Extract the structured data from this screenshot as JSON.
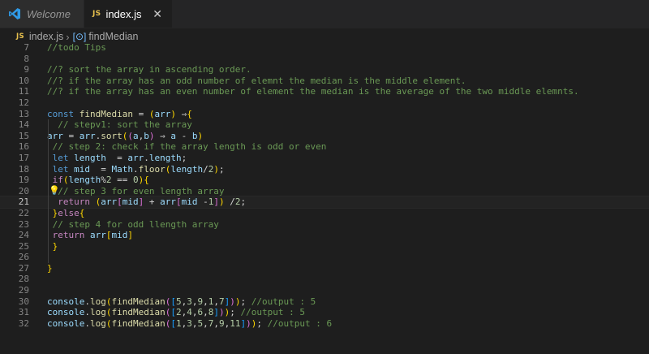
{
  "tabs": [
    {
      "label": "Welcome",
      "icon": "vscode-logo-icon",
      "active": false
    },
    {
      "label": "index.js",
      "badge": "JS",
      "icon": "js-file-icon",
      "active": true,
      "close": "✕"
    }
  ],
  "breadcrumb": {
    "file_badge": "JS",
    "file": "index.js",
    "symbol": "findMedian"
  },
  "colors": {
    "comment": "#6a9955",
    "keyword": "#569cd6",
    "function": "#dcdcaa",
    "variable": "#9cdcfe",
    "number": "#b5cea8"
  },
  "editor": {
    "current_line": 21,
    "lines": [
      {
        "n": "7",
        "t": "//todo Tips"
      },
      {
        "n": "8",
        "t": ""
      },
      {
        "n": "9",
        "t": "//? sort the array in ascending order."
      },
      {
        "n": "10",
        "t": "//? if the array has an odd number of elemnt the median is the middle element."
      },
      {
        "n": "11",
        "t": "//? if the array has an even number of element the median is the average of the two middle elemnts."
      },
      {
        "n": "12",
        "t": ""
      },
      {
        "n": "13",
        "t": "const findMedian = (arr) ⇒{"
      },
      {
        "n": "14",
        "t": "  // stepv1: sort the array"
      },
      {
        "n": "15",
        "t": "arr = arr.sort((a,b) ⇒ a - b)"
      },
      {
        "n": "16",
        "t": " // step 2: check if the array length is odd or even"
      },
      {
        "n": "17",
        "t": " let length  = arr.length;"
      },
      {
        "n": "18",
        "t": " let mid  = Math.floor(length/2);"
      },
      {
        "n": "19",
        "t": " if(length%2 == 0){"
      },
      {
        "n": "20",
        "t": "  // step 3 for even length array"
      },
      {
        "n": "21",
        "t": "  return (arr[mid] + arr[mid -1]) /2;"
      },
      {
        "n": "22",
        "t": " }else{"
      },
      {
        "n": "23",
        "t": " // step 4 for odd llength array"
      },
      {
        "n": "24",
        "t": " return arr[mid]"
      },
      {
        "n": "25",
        "t": " }"
      },
      {
        "n": "26",
        "t": ""
      },
      {
        "n": "27",
        "t": "}"
      },
      {
        "n": "28",
        "t": ""
      },
      {
        "n": "29",
        "t": ""
      },
      {
        "n": "30",
        "t": "console.log(findMedian([5,3,9,1,7])); //output : 5"
      },
      {
        "n": "31",
        "t": "console.log(findMedian([2,4,6,8])); //output : 5"
      },
      {
        "n": "32",
        "t": "console.log(findMedian([1,3,5,7,9,11])); //output : 6"
      }
    ]
  }
}
